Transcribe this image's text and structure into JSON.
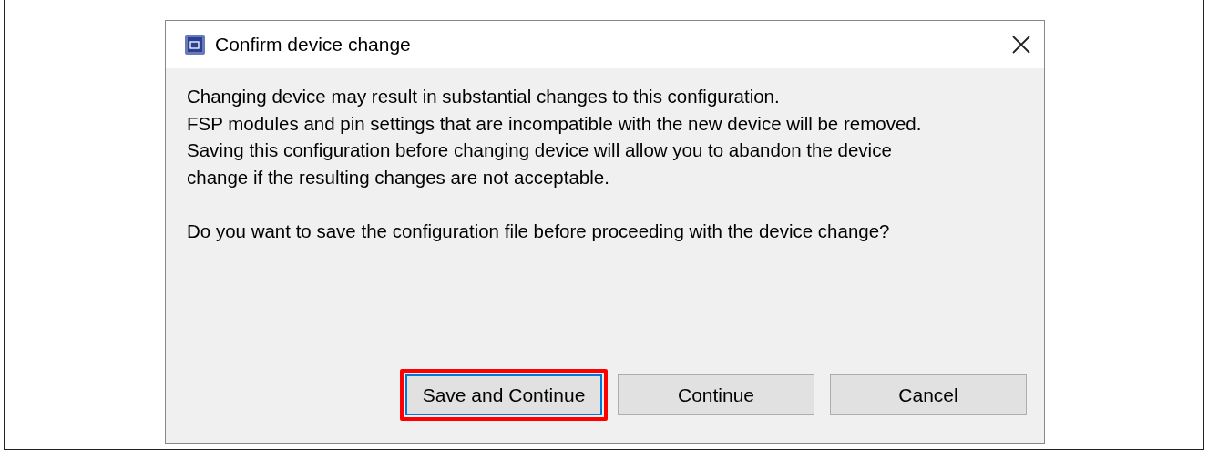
{
  "window": {
    "title": "Confirm device change"
  },
  "message": [
    [
      "Changing device may result in substantial changes to this configuration.",
      "FSP modules and pin settings that are incompatible with the new device will be removed.",
      "Saving this configuration before changing device will allow you to abandon the device change if the resulting changes are not acceptable."
    ],
    [
      "Do you want to save the configuration file before proceeding with the device change?"
    ]
  ],
  "buttons": [
    {
      "label": "Save and Continue",
      "focused": true,
      "highlighted": true
    },
    {
      "label": "Continue",
      "focused": false,
      "highlighted": false
    },
    {
      "label": "Cancel",
      "focused": false,
      "highlighted": false
    }
  ]
}
